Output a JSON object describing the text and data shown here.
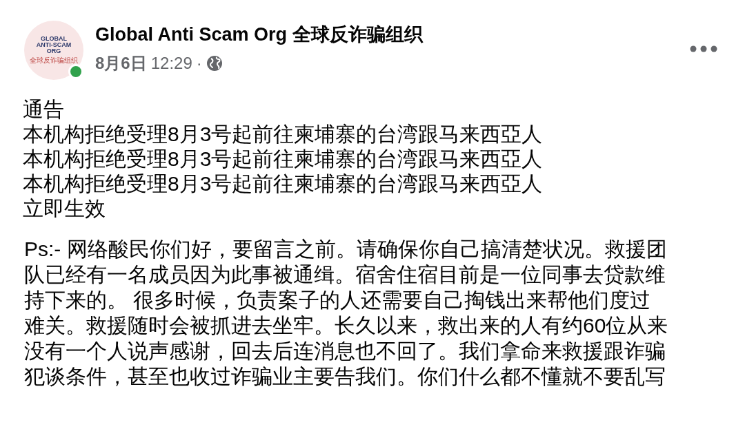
{
  "post": {
    "avatar": {
      "logo_lines": [
        "GLOBAL",
        "ANTI-SCAM",
        "ORG"
      ],
      "logo_subtitle": "全球反诈骗组织",
      "online": true
    },
    "author": "Global Anti Scam Org 全球反诈骗组织",
    "date": "8月6日",
    "time": "12:29",
    "separator": "·",
    "notice_lines": [
      "通告",
      "本机构拒绝受理8月3号起前往柬埔寨的台湾跟马来西亞人",
      "本机构拒绝受理8月3号起前往柬埔寨的台湾跟马来西亞人",
      "本机构拒绝受理8月3号起前往柬埔寨的台湾跟马来西亞人",
      "立即生效"
    ],
    "ps_lines": [
      "Ps:- 网络酸民你们好，要留言之前。请确保你自己搞清楚状况。救援团",
      "队已经有一名成员因为此事被通缉。宿舍住宿目前是一位同事去贷款维",
      "持下来的。 很多时候，负责案子的人还需要自己掏钱出来帮他们度过",
      "难关。救援随时会被抓进去坐牢。长久以来，救出来的人有约60位从来",
      "没有一个人说声感谢，回去后连消息也不回了。我们拿命来救援跟诈骗",
      "犯谈条件，甚至也收过诈骗业主要告我们。你们什么都不懂就不要乱写"
    ]
  }
}
